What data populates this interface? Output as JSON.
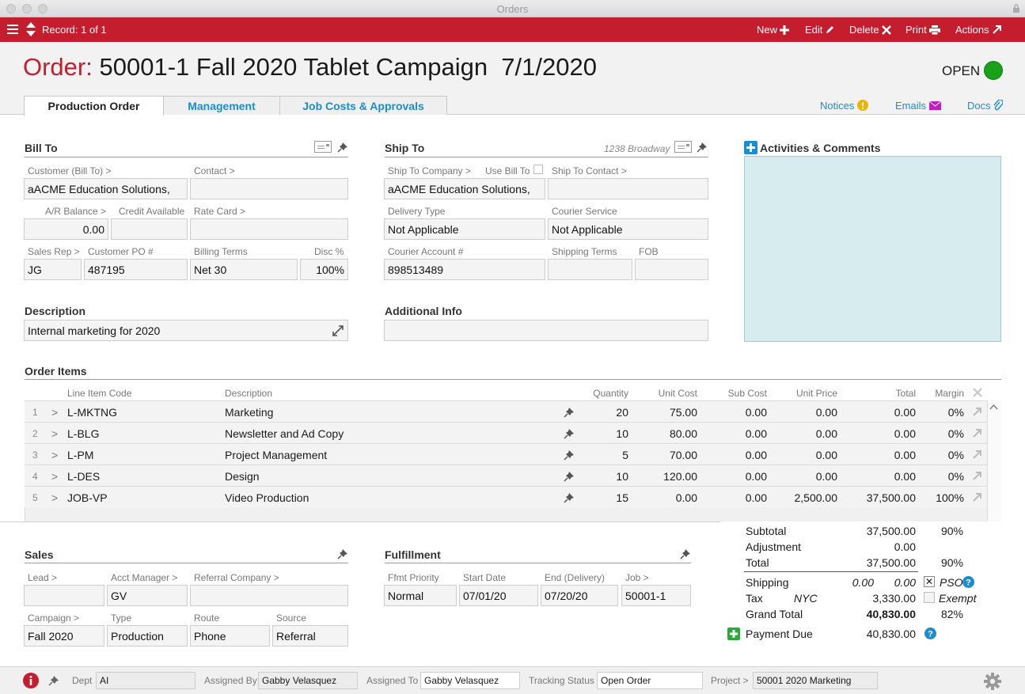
{
  "window": {
    "title": "Orders"
  },
  "toolbar": {
    "record": "Record: 1 of 1",
    "new": "New",
    "edit": "Edit",
    "delete": "Delete",
    "print": "Print",
    "actions": "Actions"
  },
  "header": {
    "order_label": "Order:",
    "order_title": "50001-1 Fall 2020 Tablet Campaign  7/1/2020",
    "status": "OPEN",
    "status_color": "#1aa11a",
    "tabs": [
      "Production Order",
      "Management",
      "Job Costs & Approvals"
    ],
    "links": {
      "notices": "Notices",
      "emails": "Emails",
      "docs": "Docs"
    }
  },
  "bill_to": {
    "title": "Bill To",
    "customer_label": "Customer (Bill To) >",
    "customer": "aACME Education Solutions,",
    "contact_label": "Contact >",
    "contact": "",
    "ar_label": "A/R Balance >",
    "ar": "0.00",
    "credit_label": "Credit Available",
    "credit": "",
    "rate_label": "Rate Card >",
    "rate": "",
    "salesrep_label": "Sales Rep >",
    "salesrep": "JG",
    "po_label": "Customer PO #",
    "po": "487195",
    "terms_label": "Billing Terms",
    "terms": "Net 30",
    "disc_label": "Disc %",
    "disc": "100%"
  },
  "ship_to": {
    "title": "Ship To",
    "address_hint": "1238 Broadway",
    "company_label": "Ship To Company >",
    "use_bill_label": "Use Bill To",
    "company": "aACME Education Solutions,",
    "contact_label": "Ship To Contact >",
    "contact": "",
    "delivery_label": "Delivery Type",
    "delivery": "Not Applicable",
    "courier_label": "Courier Service",
    "courier": "Not Applicable",
    "account_label": "Courier Account #",
    "account": "898513489",
    "shipterms_label": "Shipping Terms",
    "shipterms": "",
    "fob_label": "FOB",
    "fob": ""
  },
  "activities": {
    "title": "Activities & Comments"
  },
  "description": {
    "title": "Description",
    "value": "Internal marketing for 2020"
  },
  "additional": {
    "title": "Additional Info",
    "value": ""
  },
  "order_items": {
    "title": "Order Items",
    "columns": [
      "Line Item Code",
      "Description",
      "Quantity",
      "Unit Cost",
      "Sub Cost",
      "Unit Price",
      "Total",
      "Margin"
    ],
    "rows": [
      {
        "n": "1",
        "code": "L-MKTNG",
        "desc": "Marketing",
        "qty": "20",
        "unit_cost": "75.00",
        "sub_cost": "0.00",
        "unit_price": "0.00",
        "total": "0.00",
        "margin": "0%"
      },
      {
        "n": "2",
        "code": "L-BLG",
        "desc": "Newsletter and Ad Copy",
        "qty": "10",
        "unit_cost": "80.00",
        "sub_cost": "0.00",
        "unit_price": "0.00",
        "total": "0.00",
        "margin": "0%"
      },
      {
        "n": "3",
        "code": "L-PM",
        "desc": "Project Management",
        "qty": "5",
        "unit_cost": "70.00",
        "sub_cost": "0.00",
        "unit_price": "0.00",
        "total": "0.00",
        "margin": "0%"
      },
      {
        "n": "4",
        "code": "L-DES",
        "desc": "Design",
        "qty": "10",
        "unit_cost": "120.00",
        "sub_cost": "0.00",
        "unit_price": "0.00",
        "total": "0.00",
        "margin": "0%"
      },
      {
        "n": "5",
        "code": "JOB-VP",
        "desc": "Video Production",
        "qty": "15",
        "unit_cost": "0.00",
        "sub_cost": "0.00",
        "unit_price": "2,500.00",
        "total": "37,500.00",
        "margin": "100%"
      }
    ]
  },
  "totals": {
    "subtotal_label": "Subtotal",
    "subtotal": "37,500.00",
    "subtotal_pct": "90%",
    "adjustment_label": "Adjustment",
    "adjustment": "0.00",
    "total_label": "Total",
    "total": "37,500.00",
    "total_pct": "90%",
    "shipping_label": "Shipping",
    "shipping_a": "0.00",
    "shipping_b": "0.00",
    "pso_label": "PSO",
    "tax_label": "Tax",
    "tax_region": "NYC",
    "tax": "3,330.00",
    "exempt_label": "Exempt",
    "grand_label": "Grand Total",
    "grand": "40,830.00",
    "grand_pct": "82%",
    "due_label": "Payment Due",
    "due": "40,830.00"
  },
  "sales": {
    "title": "Sales",
    "lead_label": "Lead >",
    "lead": "",
    "acct_label": "Acct Manager >",
    "acct": "GV",
    "referral_label": "Referral Company >",
    "referral": "",
    "campaign_label": "Campaign >",
    "campaign": "Fall 2020",
    "type_label": "Type",
    "type": "Production",
    "route_label": "Route",
    "route": "Phone",
    "source_label": "Source",
    "source": "Referral"
  },
  "fulfillment": {
    "title": "Fulfillment",
    "priority_label": "Ffmt Priority",
    "priority": "Normal",
    "start_label": "Start Date",
    "start": "07/01/20",
    "end_label": "End (Delivery)",
    "end": "07/20/20",
    "job_label": "Job >",
    "job": "50001-1"
  },
  "footer": {
    "dept_label": "Dept",
    "dept": "AI",
    "assigned_by_label": "Assigned By",
    "assigned_by": "Gabby Velasquez",
    "assigned_to_label": "Assigned To",
    "assigned_to": "Gabby Velasquez",
    "tracking_label": "Tracking Status",
    "tracking": "Open Order",
    "project_label": "Project >",
    "project": "50001 2020 Marketing"
  }
}
